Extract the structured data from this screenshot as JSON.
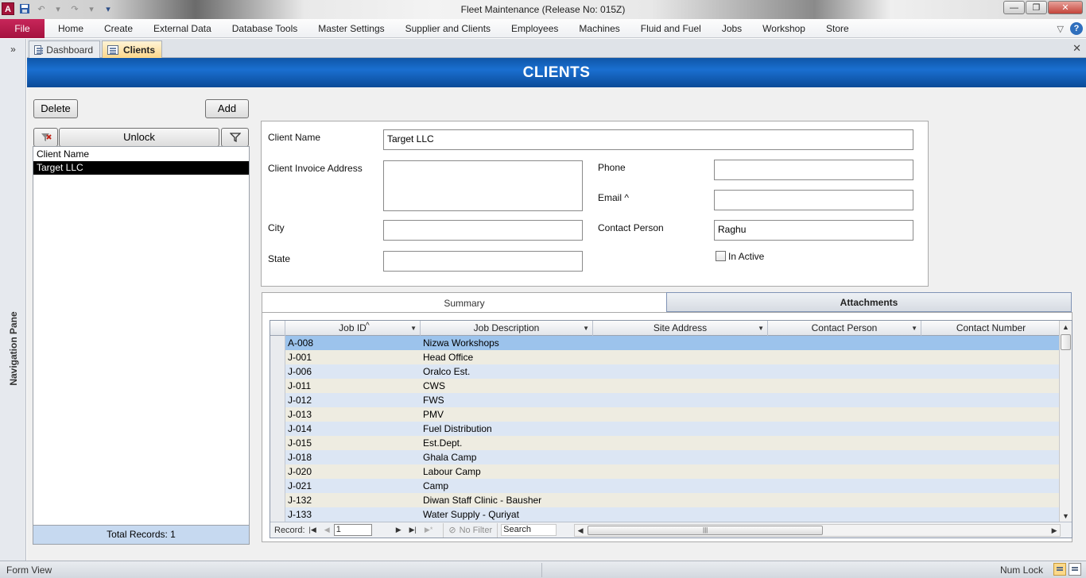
{
  "window": {
    "title": "Fleet Maintenance (Release No: 015Z)",
    "app_icon_letter": "A",
    "controls": [
      "—",
      "❐",
      "✕"
    ]
  },
  "ribbon": {
    "file_label": "File",
    "tabs": [
      "Home",
      "Create",
      "External Data",
      "Database Tools",
      "Master Settings",
      "Supplier and Clients",
      "Employees",
      "Machines",
      "Fluid and Fuel",
      "Jobs",
      "Workshop",
      "Store"
    ]
  },
  "nav_pane": {
    "label": "Navigation Pane",
    "expand": "»"
  },
  "doc_tabs": [
    {
      "label": "Dashboard",
      "active": false
    },
    {
      "label": "Clients",
      "active": true
    }
  ],
  "form": {
    "header": "CLIENTS",
    "delete_label": "Delete",
    "add_label": "Add",
    "unlock_label": "Unlock",
    "list_header": "Client Name",
    "clients": [
      "Target LLC"
    ],
    "total_records": "Total Records: 1",
    "fields": {
      "client_name_label": "Client Name",
      "client_name_value": "Target LLC",
      "invoice_address_label": "Client Invoice Address",
      "invoice_address_value": "",
      "city_label": "City",
      "city_value": "",
      "state_label": "State",
      "state_value": "",
      "phone_label": "Phone",
      "phone_value": "",
      "email_label": "Email ^",
      "email_value": "",
      "contact_label": "Contact Person",
      "contact_value": "Raghu",
      "inactive_label": "In Active"
    },
    "tabs": {
      "summary": "Summary",
      "attachments": "Attachments"
    },
    "grid": {
      "columns": [
        "Job ID",
        "Job Description",
        "Site Address",
        "Contact Person",
        "Contact Number"
      ],
      "sort_indicator": "^",
      "rows": [
        [
          "A-008",
          "Nizwa Workshops",
          "",
          "",
          ""
        ],
        [
          "J-001",
          "Head Office",
          "",
          "",
          ""
        ],
        [
          "J-006",
          "Oralco Est.",
          "",
          "",
          ""
        ],
        [
          "J-011",
          "CWS",
          "",
          "",
          ""
        ],
        [
          "J-012",
          "FWS",
          "",
          "",
          ""
        ],
        [
          "J-013",
          "PMV",
          "",
          "",
          ""
        ],
        [
          "J-014",
          "Fuel Distribution",
          "",
          "",
          ""
        ],
        [
          "J-015",
          "Est.Dept.",
          "",
          "",
          ""
        ],
        [
          "J-018",
          "Ghala Camp",
          "",
          "",
          ""
        ],
        [
          "J-020",
          "Labour Camp",
          "",
          "",
          ""
        ],
        [
          "J-021",
          "Camp",
          "",
          "",
          ""
        ],
        [
          "J-132",
          "Diwan Staff Clinic - Bausher",
          "",
          "",
          ""
        ],
        [
          "J-133",
          "Water Supply - Quriyat",
          "",
          "",
          ""
        ]
      ]
    },
    "record_nav": {
      "record_label": "Record:",
      "record_value": "1",
      "no_filter": "No Filter",
      "search_placeholder": "Search"
    }
  },
  "status": {
    "view": "Form View",
    "numlock": "Num Lock"
  }
}
